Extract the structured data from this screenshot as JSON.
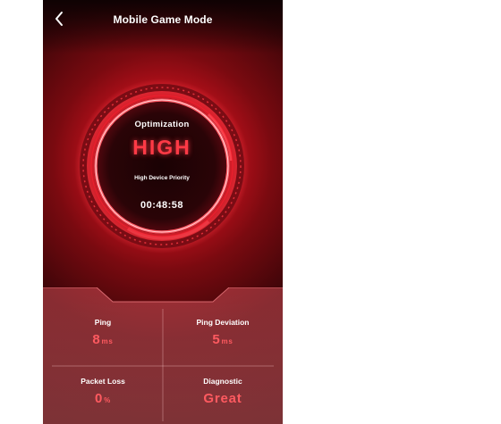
{
  "header": {
    "title": "Mobile Game Mode"
  },
  "optimization": {
    "label": "Optimization",
    "level": "HIGH",
    "priority_text": "High Device Priority",
    "timer": "00:48:58"
  },
  "stats": {
    "ping": {
      "label": "Ping",
      "value": "8",
      "unit": "ms"
    },
    "ping_deviation": {
      "label": "Ping Deviation",
      "value": "5",
      "unit": "ms"
    },
    "packet_loss": {
      "label": "Packet Loss",
      "value": "0",
      "unit": "%"
    },
    "diagnostic": {
      "label": "Diagnostic",
      "value": "Great"
    }
  },
  "colors": {
    "accent": "#ff3a46",
    "background_dark": "#2a0407",
    "value_red": "#ff5a60"
  },
  "icons": {
    "back": "chevron-left-icon"
  }
}
